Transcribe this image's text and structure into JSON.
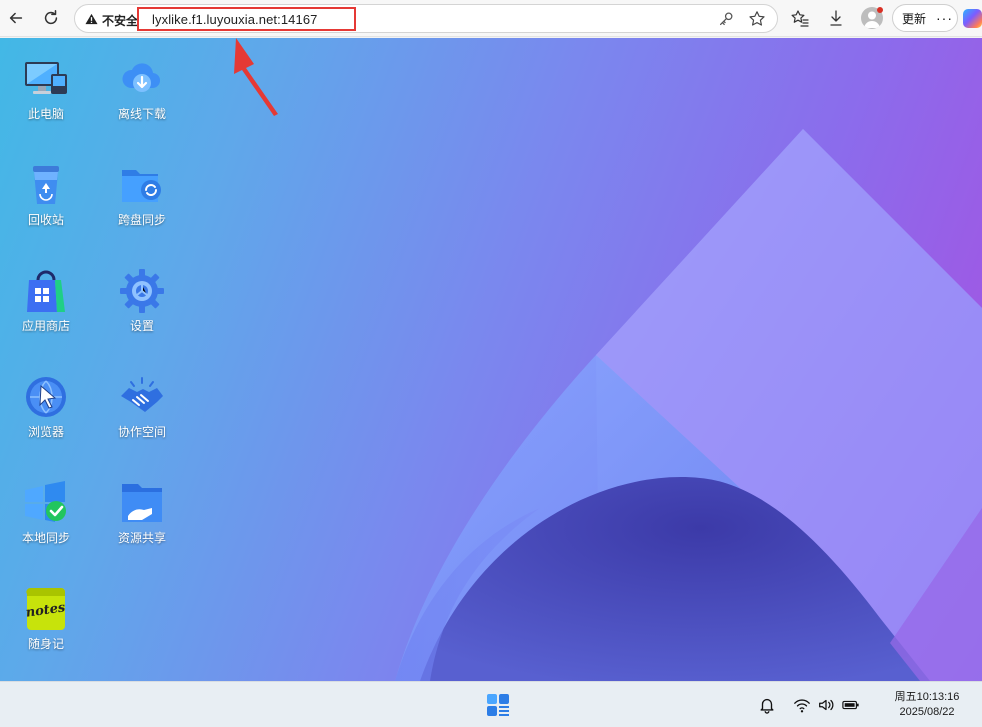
{
  "browser": {
    "security_label": "不安全",
    "url": "lyxlike.f1.luyouxia.net:14167",
    "update_label": "更新",
    "more_label": "···"
  },
  "desktop": {
    "icons": [
      {
        "label": "此电脑",
        "icon": "computer-icon"
      },
      {
        "label": "离线下载",
        "icon": "cloud-download-icon"
      },
      {
        "label": "回收站",
        "icon": "recycle-bin-icon"
      },
      {
        "label": "跨盘同步",
        "icon": "folder-sync-icon"
      },
      {
        "label": "应用商店",
        "icon": "app-store-bag-icon"
      },
      {
        "label": "设置",
        "icon": "gear-icon"
      },
      {
        "label": "浏览器",
        "icon": "browser-globe-icon"
      },
      {
        "label": "协作空间",
        "icon": "handshake-icon"
      },
      {
        "label": "本地同步",
        "icon": "local-sync-icon"
      },
      {
        "label": "资源共享",
        "icon": "shared-folder-icon"
      },
      {
        "label": "随身记",
        "icon": "notes-icon"
      }
    ]
  },
  "taskbar": {
    "time": "周五10:13:16",
    "date": "2025/08/22"
  },
  "colors": {
    "annotation_red": "#e53935",
    "wallpaper_start": "#42b8e6",
    "wallpaper_end": "#a84fe0"
  }
}
